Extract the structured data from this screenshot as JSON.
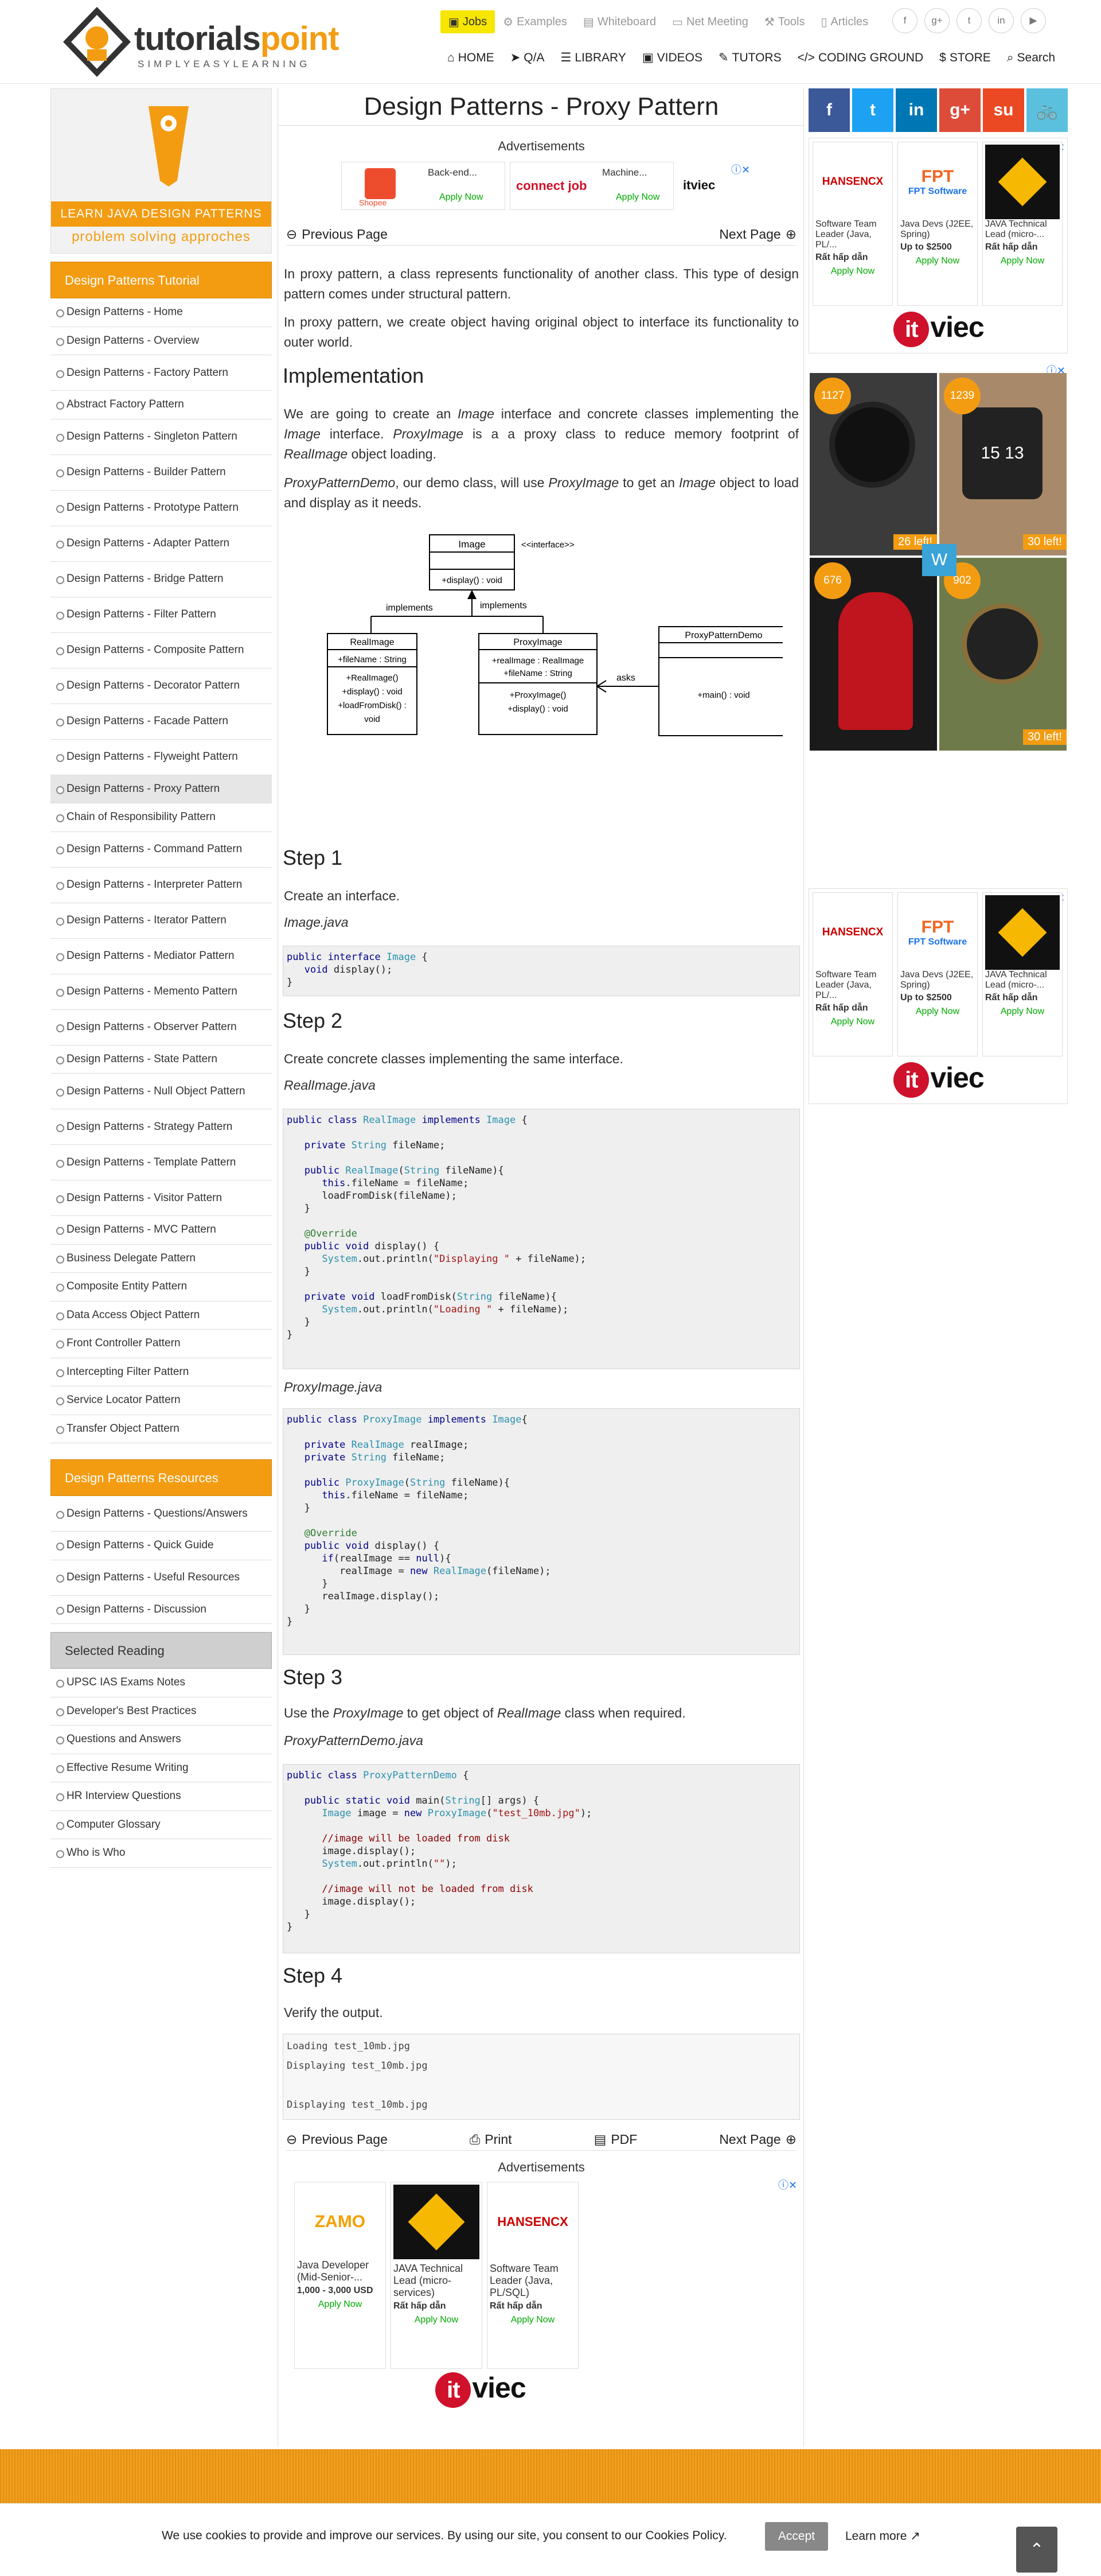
{
  "header": {
    "logo_word_a": "tutorials",
    "logo_word_b": "point",
    "logo_tag": "SIMPLYEASYLEARNING",
    "toplinks": [
      "Jobs",
      "Examples",
      "Whiteboard",
      "Net Meeting",
      "Tools",
      "Articles"
    ],
    "social": [
      "f",
      "g+",
      "t",
      "in",
      "▶"
    ],
    "nav": [
      "HOME",
      "Q/A",
      "LIBRARY",
      "VIDEOS",
      "TUTORS",
      "CODING GROUND",
      "STORE",
      "Search"
    ]
  },
  "sidebar": {
    "banner_ribbon": "LEARN JAVA DESIGN PATTERNS",
    "banner_sub": "problem solving approches",
    "tutorial_heading": "Design Patterns Tutorial",
    "items": [
      "Design Patterns - Home",
      "Design Patterns - Overview",
      "Design Patterns - Factory Pattern",
      "Abstract Factory Pattern",
      "Design Patterns - Singleton Pattern",
      "Design Patterns - Builder Pattern",
      "Design Patterns - Prototype Pattern",
      "Design Patterns - Adapter Pattern",
      "Design Patterns - Bridge Pattern",
      "Design Patterns - Filter Pattern",
      "Design Patterns - Composite Pattern",
      "Design Patterns - Decorator Pattern",
      "Design Patterns - Facade Pattern",
      "Design Patterns - Flyweight Pattern",
      "Design Patterns - Proxy Pattern",
      "Chain of Responsibility Pattern",
      "Design Patterns - Command Pattern",
      "Design Patterns - Interpreter Pattern",
      "Design Patterns - Iterator Pattern",
      "Design Patterns - Mediator Pattern",
      "Design Patterns - Memento Pattern",
      "Design Patterns - Observer Pattern",
      "Design Patterns - State Pattern",
      "Design Patterns - Null Object Pattern",
      "Design Patterns - Strategy Pattern",
      "Design Patterns - Template Pattern",
      "Design Patterns - Visitor Pattern",
      "Design Patterns - MVC Pattern",
      "Business Delegate Pattern",
      "Composite Entity Pattern",
      "Data Access Object Pattern",
      "Front Controller Pattern",
      "Intercepting Filter Pattern",
      "Service Locator Pattern",
      "Transfer Object Pattern"
    ],
    "resources_heading": "Design Patterns Resources",
    "resources": [
      "Design Patterns - Questions/Answers",
      "Design Patterns - Quick Guide",
      "Design Patterns - Useful Resources",
      "Design Patterns - Discussion"
    ],
    "reading_heading": "Selected Reading",
    "reading": [
      "UPSC IAS Exams Notes",
      "Developer's Best Practices",
      "Questions and Answers",
      "Effective Resume Writing",
      "HR Interview Questions",
      "Computer Glossary",
      "Who is Who"
    ]
  },
  "content": {
    "title": "Design Patterns - Proxy Pattern",
    "ad_label": "Advertisements",
    "top_ads": [
      {
        "brand": "Shopee",
        "title": "Back-end...",
        "cta": "Apply Now"
      },
      {
        "brand": "connect job",
        "title": "Machine...",
        "cta": "Apply Now"
      }
    ],
    "ad_brand_small": "itviec",
    "prev": "Previous Page",
    "next": "Next Page",
    "intro1": "In proxy pattern, a class represents functionality of another class. This type of design pattern comes under structural pattern.",
    "intro2": "In proxy pattern, we create object having original object to interface its functionality to outer world.",
    "impl_heading": "Implementation",
    "impl_p1_a": "We are going to create an ",
    "impl_p1_b": "Image",
    "impl_p1_c": " interface and concrete classes implementing the ",
    "impl_p1_d": "Image",
    "impl_p1_e": " interface. ",
    "impl_p1_f": "ProxyImage",
    "impl_p1_g": " is a a proxy class to reduce memory footprint of ",
    "impl_p1_h": "RealImage",
    "impl_p1_i": " object loading.",
    "impl_p2_a": "ProxyPatternDemo",
    "impl_p2_b": ", our demo class, will use ",
    "impl_p2_c": "ProxyImage",
    "impl_p2_d": " to get an ",
    "impl_p2_e": "Image",
    "impl_p2_f": " object to load and display as it needs.",
    "uml": {
      "image_name": "Image",
      "image_stereo": "<<interface>>",
      "image_method": "+display() : void",
      "implements": "implements",
      "real_name": "RealImage",
      "real_attr": "+fileName : String",
      "real_m1": "+RealImage()",
      "real_m2": "+display() : void",
      "real_m3": "+loadFromDisk() :",
      "real_m4": "void",
      "proxy_name": "ProxyImage",
      "proxy_a1": "+realImage : RealImage",
      "proxy_a2": "+fileName : String",
      "proxy_m1": "+ProxyImage()",
      "proxy_m2": "+display() : void",
      "asks": "asks",
      "demo_name": "ProxyPatternDemo",
      "demo_m1": "+main() : void"
    },
    "step1": "Step 1",
    "step1_text": "Create an interface.",
    "file1": "Image.java",
    "step2": "Step 2",
    "step2_text": "Create concrete classes implementing the same interface.",
    "file2": "RealImage.java",
    "file3": "ProxyImage.java",
    "step3": "Step 3",
    "step3_a": "Use the ",
    "step3_b": "ProxyImage",
    "step3_c": " to get object of ",
    "step3_d": "RealImage",
    "step3_e": " class when required.",
    "file4": "ProxyPatternDemo.java",
    "step4": "Step 4",
    "step4_text": "Verify the output.",
    "output": "Loading test_10mb.jpg\nDisplaying test_10mb.jpg\n\nDisplaying test_10mb.jpg",
    "bottom_nav": [
      "Previous Page",
      "Print",
      "PDF",
      "Next Page"
    ],
    "bottom_ads": [
      {
        "brand": "ZAMO",
        "title": "Java Developer (Mid-Senior-...",
        "salary": "1,000 - 3,000 USD",
        "cta": "Apply Now"
      },
      {
        "brand": "",
        "title": "JAVA Technical Lead (micro-services)",
        "salary": "Rất hấp dẫn",
        "cta": "Apply Now"
      },
      {
        "brand": "HANSENCX",
        "title": "Software Team Leader (Java, PL/SQL)",
        "salary": "Rất hấp dẫn",
        "cta": "Apply Now"
      }
    ]
  },
  "right": {
    "social": [
      "f",
      "t",
      "in",
      "g+",
      "su",
      "🚲"
    ],
    "ads": [
      {
        "brand": "HANSENCX",
        "title": "Software Team Leader (Java, PL/...",
        "salary": "Rất hấp dẫn",
        "cta": "Apply Now"
      },
      {
        "brand": "FPT Software",
        "title": "Java Devs (J2EE, Spring)",
        "salary": "Up to $2500",
        "cta": "Apply Now"
      },
      {
        "brand": "",
        "title": "JAVA Technical Lead (micro-...",
        "salary": "Rất hấp dẫn",
        "cta": "Apply Now"
      }
    ],
    "watch_counts": [
      "1127",
      "1239",
      "676",
      "902"
    ],
    "watch_left": [
      "26 left!",
      "30 left!",
      "30 left!"
    ],
    "watch_date": "15 13"
  },
  "cookie": {
    "message": "We use cookies to provide and improve our services. By using our site, you consent to our Cookies Policy.",
    "accept": "Accept",
    "learn": "Learn more"
  },
  "colors": {
    "accent": "#f39c12",
    "facebook": "#3b5998",
    "twitter": "#1da1f2",
    "linkedin": "#0077b5",
    "gplus": "#dd4b39",
    "stumble": "#eb4924"
  }
}
